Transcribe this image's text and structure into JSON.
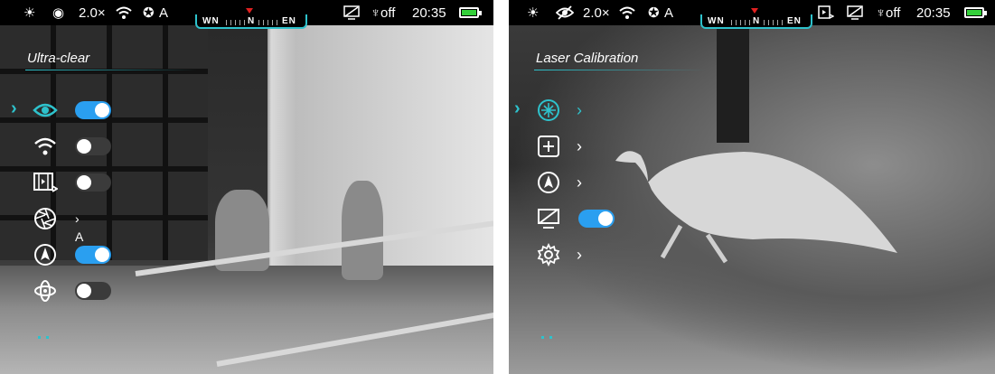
{
  "left": {
    "status": {
      "zoom": "2.0×",
      "mode_letter": "A",
      "compass_left": "WN",
      "compass_center": "N",
      "compass_right": "EN",
      "power_off": "off",
      "time": "20:35"
    },
    "menu_title": "Ultra-clear",
    "items": [
      {
        "icon": "eye-icon",
        "control": "toggle",
        "state": "on"
      },
      {
        "icon": "wifi-icon",
        "control": "toggle",
        "state": "off"
      },
      {
        "icon": "video-record-icon",
        "control": "toggle",
        "state": "off"
      },
      {
        "icon": "aperture-icon",
        "control": "chevron-text",
        "value": "A"
      },
      {
        "icon": "compass-icon",
        "control": "toggle",
        "state": "on"
      },
      {
        "icon": "stabilizer-icon",
        "control": "toggle",
        "state": "off"
      }
    ]
  },
  "right": {
    "status": {
      "zoom": "2.0×",
      "mode_letter": "A",
      "compass_left": "WN",
      "compass_center": "N",
      "compass_right": "EN",
      "power_off": "off",
      "time": "20:35"
    },
    "menu_title": "Laser Calibration",
    "items": [
      {
        "icon": "laser-target-icon",
        "control": "chevron"
      },
      {
        "icon": "crosshair-add-icon",
        "control": "chevron"
      },
      {
        "icon": "compass-icon",
        "control": "chevron"
      },
      {
        "icon": "screen-off-icon",
        "control": "toggle",
        "state": "on"
      },
      {
        "icon": "settings-gear-icon",
        "control": "chevron"
      }
    ]
  },
  "colors": {
    "accent": "#2ec2cc",
    "toggle_on": "#2a9ff0",
    "toggle_off": "#3b3b3b",
    "battery": "#34d03a",
    "compass_north": "#e02020"
  }
}
